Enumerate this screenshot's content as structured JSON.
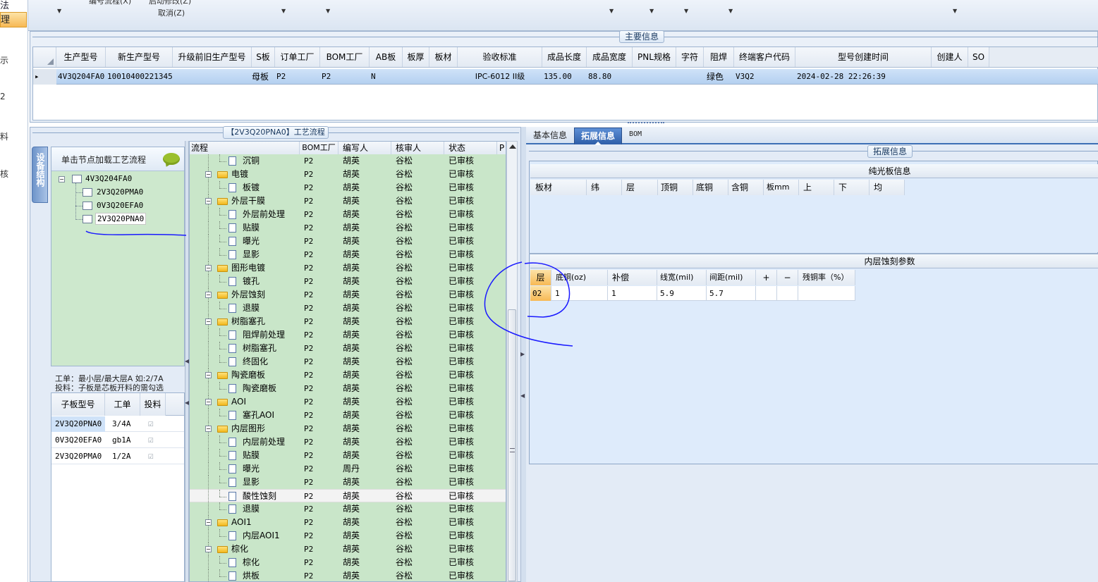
{
  "toolbar": {
    "left_fragments": [
      "法",
      "理"
    ],
    "menu_fragments": [
      "编号流程(X)",
      "启动修改(Z)",
      "取消(Z)"
    ]
  },
  "left_nav": {
    "items": [
      "示",
      "2",
      "料",
      "核"
    ]
  },
  "main_info": {
    "title": "主要信息",
    "columns": [
      "生产型号",
      "新生产型号",
      "升级前旧生产型号",
      "S板",
      "订单工厂",
      "BOM工厂",
      "AB板",
      "板厚",
      "板材",
      "验收标准",
      "成品长度",
      "成品宽度",
      "PNL规格",
      "字符",
      "阻焊",
      "终端客户代码",
      "型号创建时间",
      "创建人",
      "SO"
    ],
    "row": {
      "marker": "▸",
      "cells": [
        "4V3Q204FA0",
        "10010400221345",
        "",
        "母板",
        "P2",
        "P2",
        "N",
        "",
        "",
        "IPC-6012 II级",
        "135.00",
        "88.80",
        "",
        "",
        "绿色",
        "V3Q2",
        "2024-02-28 22:26:39",
        "",
        ""
      ]
    }
  },
  "process": {
    "title": "【2V3Q20PNA0】工艺流程",
    "side_tab": "设备结构",
    "tree_header": "单击节点加载工艺流程",
    "tree": {
      "root": "4V3Q204FA0",
      "children": [
        "2V3Q20PMA0",
        "0V3Q20EFA0",
        "2V3Q20PNA0"
      ]
    },
    "note_line1": "工单：最小层/最大层A 如:2/7A",
    "note_line2": "投料：子板是芯板开料的需勾选",
    "sub_table": {
      "columns": [
        "子板型号",
        "工单",
        "投料"
      ],
      "rows": [
        {
          "model": "2V3Q20PNA0",
          "order": "3/4A",
          "feed": "☑"
        },
        {
          "model": "0V3Q20EFA0",
          "order": "gb1A",
          "feed": "☑"
        },
        {
          "model": "2V3Q20PMA0",
          "order": "1/2A",
          "feed": "☑"
        }
      ]
    },
    "flow_columns": [
      "流程",
      "BOM工厂",
      "编写人",
      "核审人",
      "状态",
      "P"
    ],
    "flow_rows": [
      {
        "name": "沉铜",
        "level": 2,
        "bom": "P2",
        "writer": "胡英",
        "reviewer": "谷松",
        "status": "已审核"
      },
      {
        "name": "电镀",
        "level": 1,
        "bom": "P2",
        "writer": "胡英",
        "reviewer": "谷松",
        "status": "已审核"
      },
      {
        "name": "板镀",
        "level": 2,
        "bom": "P2",
        "writer": "胡英",
        "reviewer": "谷松",
        "status": "已审核"
      },
      {
        "name": "外层干膜",
        "level": 1,
        "bom": "P2",
        "writer": "胡英",
        "reviewer": "谷松",
        "status": "已审核"
      },
      {
        "name": "外层前处理",
        "level": 2,
        "bom": "P2",
        "writer": "胡英",
        "reviewer": "谷松",
        "status": "已审核"
      },
      {
        "name": "贴膜",
        "level": 2,
        "bom": "P2",
        "writer": "胡英",
        "reviewer": "谷松",
        "status": "已审核"
      },
      {
        "name": "曝光",
        "level": 2,
        "bom": "P2",
        "writer": "胡英",
        "reviewer": "谷松",
        "status": "已审核"
      },
      {
        "name": "显影",
        "level": 2,
        "bom": "P2",
        "writer": "胡英",
        "reviewer": "谷松",
        "status": "已审核"
      },
      {
        "name": "图形电镀",
        "level": 1,
        "bom": "P2",
        "writer": "胡英",
        "reviewer": "谷松",
        "status": "已审核"
      },
      {
        "name": "镀孔",
        "level": 2,
        "bom": "P2",
        "writer": "胡英",
        "reviewer": "谷松",
        "status": "已审核"
      },
      {
        "name": "外层蚀刻",
        "level": 1,
        "bom": "P2",
        "writer": "胡英",
        "reviewer": "谷松",
        "status": "已审核"
      },
      {
        "name": "退膜",
        "level": 2,
        "bom": "P2",
        "writer": "胡英",
        "reviewer": "谷松",
        "status": "已审核"
      },
      {
        "name": "树脂塞孔",
        "level": 1,
        "bom": "P2",
        "writer": "胡英",
        "reviewer": "谷松",
        "status": "已审核"
      },
      {
        "name": "阻焊前处理",
        "level": 2,
        "bom": "P2",
        "writer": "胡英",
        "reviewer": "谷松",
        "status": "已审核"
      },
      {
        "name": "树脂塞孔",
        "level": 2,
        "bom": "P2",
        "writer": "胡英",
        "reviewer": "谷松",
        "status": "已审核"
      },
      {
        "name": "终固化",
        "level": 2,
        "bom": "P2",
        "writer": "胡英",
        "reviewer": "谷松",
        "status": "已审核"
      },
      {
        "name": "陶瓷磨板",
        "level": 1,
        "bom": "P2",
        "writer": "胡英",
        "reviewer": "谷松",
        "status": "已审核"
      },
      {
        "name": "陶瓷磨板",
        "level": 2,
        "bom": "P2",
        "writer": "胡英",
        "reviewer": "谷松",
        "status": "已审核"
      },
      {
        "name": "AOI",
        "level": 1,
        "bom": "P2",
        "writer": "胡英",
        "reviewer": "谷松",
        "status": "已审核"
      },
      {
        "name": "塞孔AOI",
        "level": 2,
        "bom": "P2",
        "writer": "胡英",
        "reviewer": "谷松",
        "status": "已审核"
      },
      {
        "name": "内层图形",
        "level": 1,
        "bom": "P2",
        "writer": "胡英",
        "reviewer": "谷松",
        "status": "已审核"
      },
      {
        "name": "内层前处理",
        "level": 2,
        "bom": "P2",
        "writer": "胡英",
        "reviewer": "谷松",
        "status": "已审核"
      },
      {
        "name": "贴膜",
        "level": 2,
        "bom": "P2",
        "writer": "胡英",
        "reviewer": "谷松",
        "status": "已审核"
      },
      {
        "name": "曝光",
        "level": 2,
        "bom": "P2",
        "writer": "周丹",
        "reviewer": "谷松",
        "status": "已审核"
      },
      {
        "name": "显影",
        "level": 2,
        "bom": "P2",
        "writer": "胡英",
        "reviewer": "谷松",
        "status": "已审核"
      },
      {
        "name": "酸性蚀刻",
        "level": 2,
        "bom": "P2",
        "writer": "胡英",
        "reviewer": "谷松",
        "status": "已审核",
        "selected": true
      },
      {
        "name": "退膜",
        "level": 2,
        "bom": "P2",
        "writer": "胡英",
        "reviewer": "谷松",
        "status": "已审核"
      },
      {
        "name": "AOI1",
        "level": 1,
        "bom": "P2",
        "writer": "胡英",
        "reviewer": "谷松",
        "status": "已审核"
      },
      {
        "name": "内层AOI1",
        "level": 2,
        "bom": "P2",
        "writer": "胡英",
        "reviewer": "谷松",
        "status": "已审核"
      },
      {
        "name": "棕化",
        "level": 1,
        "bom": "P2",
        "writer": "胡英",
        "reviewer": "谷松",
        "status": "已审核"
      },
      {
        "name": "棕化",
        "level": 2,
        "bom": "P2",
        "writer": "胡英",
        "reviewer": "谷松",
        "status": "已审核"
      },
      {
        "name": "烘板",
        "level": 2,
        "bom": "P2",
        "writer": "胡英",
        "reviewer": "谷松",
        "status": "已审核"
      }
    ]
  },
  "detail": {
    "tabs": [
      "基本信息",
      "拓展信息",
      "BOM"
    ],
    "active_tab": 1,
    "group_title": "拓展信息",
    "bare_board": {
      "title": "纯光板信息",
      "columns": [
        "板材",
        "纬",
        "层",
        "顶铜",
        "底铜",
        "含铜",
        "板mm",
        "上",
        "下",
        "均"
      ]
    },
    "inner_etch": {
      "title": "内层蚀刻参数",
      "columns": [
        "层",
        "底铜(oz)",
        "补偿",
        "线宽(mil)",
        "间距(mil)",
        "+",
        "−",
        "残铜率（%）"
      ],
      "row": [
        "02",
        "1",
        "1",
        "5.9",
        "5.7",
        "",
        "",
        ""
      ]
    }
  },
  "colors": {
    "accent": "#3d6fb5",
    "tree_green": "#cde8cd",
    "grid_green": "#c9e6c9",
    "header_blue": "#dfe8f5",
    "annotation": "#1a1aff"
  }
}
